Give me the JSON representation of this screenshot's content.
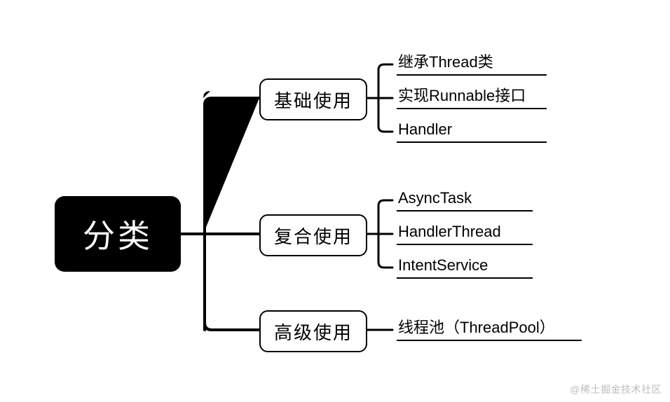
{
  "root": {
    "label": "分类"
  },
  "branches": [
    {
      "label": "基础使用",
      "leaves": [
        "继承Thread类",
        "实现Runnable接口",
        "Handler"
      ]
    },
    {
      "label": "复合使用",
      "leaves": [
        "AsyncTask",
        "HandlerThread",
        "IntentService"
      ]
    },
    {
      "label": "高级使用",
      "leaves": [
        "线程池（ThreadPool）"
      ]
    }
  ],
  "watermark": "@稀土掘金技术社区",
  "chart_data": {
    "type": "tree",
    "root": "分类",
    "children": [
      {
        "name": "基础使用",
        "children": [
          "继承Thread类",
          "实现Runnable接口",
          "Handler"
        ]
      },
      {
        "name": "复合使用",
        "children": [
          "AsyncTask",
          "HandlerThread",
          "IntentService"
        ]
      },
      {
        "name": "高级使用",
        "children": [
          "线程池（ThreadPool）"
        ]
      }
    ]
  }
}
